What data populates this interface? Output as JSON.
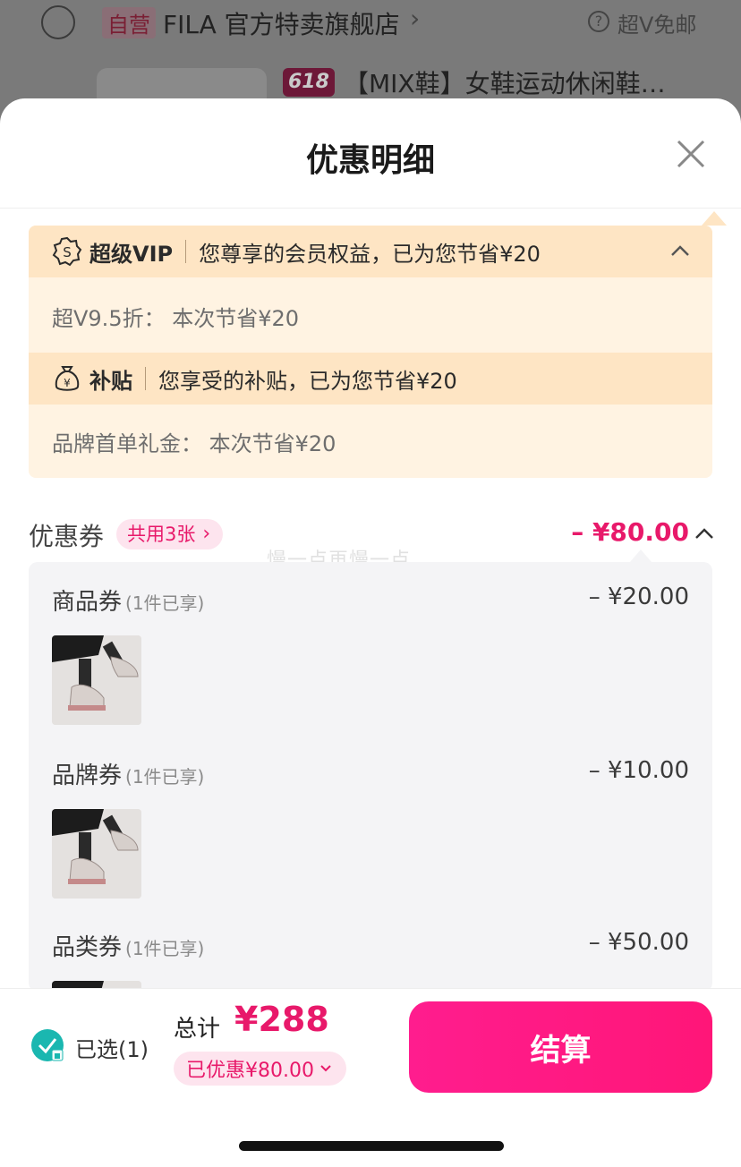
{
  "background_page": {
    "self_tag": "自营",
    "store_name": "FILA 官方特卖旗舰店",
    "store_chevron": "›",
    "help_glyph": "?",
    "free_shipping": "超V免邮",
    "promo_tag": "618",
    "product_title": "【MIX鞋】女鞋运动休闲鞋…"
  },
  "sheet": {
    "title": "优惠明细",
    "close_icon": "close-icon"
  },
  "savings": {
    "vip": {
      "label": "超级VIP",
      "desc": "您尊享的会员权益，已为您节省¥20",
      "line": "超V9.5折：   本次节省¥20"
    },
    "subsidy": {
      "label": "补贴",
      "desc": "您享受的补贴，已为您节省¥20",
      "line": "品牌首单礼金：   本次节省¥20"
    }
  },
  "coupons": {
    "title": "优惠券",
    "pill": "共用3张",
    "pill_arrow": "›",
    "total": "– ¥80.00",
    "watermark": "慢一点再慢一点",
    "items": [
      {
        "name": "商品券",
        "note": "(1件已享)",
        "amount": "– ¥20.00"
      },
      {
        "name": "品牌券",
        "note": "(1件已享)",
        "amount": "– ¥10.00"
      },
      {
        "name": "品类券",
        "note": "(1件已享)",
        "amount": "– ¥50.00"
      }
    ]
  },
  "footer": {
    "selected": "已选(1)",
    "total_label": "总计",
    "total_value": "¥288",
    "discount": "已优惠¥80.00",
    "checkout": "结算"
  },
  "colors": {
    "accent": "#e8196a",
    "vip_header_bg": "#fee5c4",
    "vip_panel_bg": "#fff3e2",
    "coupon_panel_bg": "#f4f4f6",
    "check_teal": "#1ab7b0"
  }
}
